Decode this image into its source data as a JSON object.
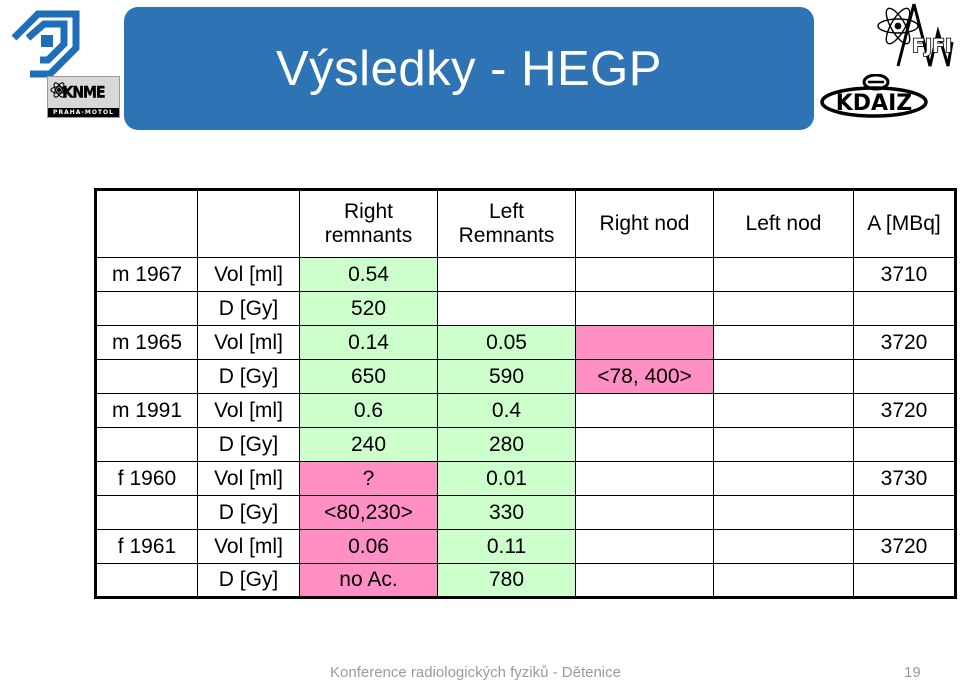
{
  "slide": {
    "title": "Výsledky - HEGP",
    "banner_color": "#2E74B5",
    "logos": {
      "motol_mark": "motol-diamond-logo",
      "knme_word": "KNME",
      "knme_sub": "PRAHA-MOTOL",
      "fjfi_word": "FJFI",
      "kdaiz_word": "KDAIZ"
    }
  },
  "footer": {
    "text": "Konference radiologických fyziků - Dětenice",
    "page": "19"
  },
  "table": {
    "headers": [
      "",
      "",
      "Right remnants",
      "Left Remnants",
      "Right nod",
      "Left nod",
      "A [MBq]"
    ],
    "header_lines": {
      "col3_line1": "Right",
      "col3_line2": "remnants",
      "col4_line1": "Left",
      "col4_line2": "Remnants",
      "col5": "Right nod",
      "col6": "Left nod",
      "col7": "A [MBq]"
    },
    "colors": {
      "green_bg": "#CCFFCC",
      "green_fg": "#006400",
      "pink_bg": "#FF8FC4",
      "pink_fg": "#800080"
    },
    "rows": [
      {
        "patient": "m 1967",
        "metric": "Vol [ml]",
        "right_remnants": "0.54",
        "left_remnants": "",
        "right_nod": "",
        "left_nod": "",
        "activity": "3710"
      },
      {
        "patient": "",
        "metric": "D [Gy]",
        "right_remnants": "520",
        "left_remnants": "",
        "right_nod": "",
        "left_nod": "",
        "activity": ""
      },
      {
        "patient": "m 1965",
        "metric": "Vol [ml]",
        "right_remnants": "0.14",
        "left_remnants": "0.05",
        "right_nod": "",
        "left_nod": "",
        "activity": "3720"
      },
      {
        "patient": "",
        "metric": "D [Gy]",
        "right_remnants": "650",
        "left_remnants": "590",
        "right_nod": "<78, 400>",
        "left_nod": "",
        "activity": ""
      },
      {
        "patient": "m 1991",
        "metric": "Vol [ml]",
        "right_remnants": "0.6",
        "left_remnants": "0.4",
        "right_nod": "",
        "left_nod": "",
        "activity": "3720"
      },
      {
        "patient": "",
        "metric": "D [Gy]",
        "right_remnants": "240",
        "left_remnants": "280",
        "right_nod": "",
        "left_nod": "",
        "activity": ""
      },
      {
        "patient": "f 1960",
        "metric": "Vol [ml]",
        "right_remnants": "?",
        "left_remnants": "0.01",
        "right_nod": "",
        "left_nod": "",
        "activity": "3730"
      },
      {
        "patient": "",
        "metric": "D [Gy]",
        "right_remnants": "<80,230>",
        "left_remnants": "330",
        "right_nod": "",
        "left_nod": "",
        "activity": ""
      },
      {
        "patient": "f 1961",
        "metric": "Vol [ml]",
        "right_remnants": "0.06",
        "left_remnants": "0.11",
        "right_nod": "",
        "left_nod": "",
        "activity": "3720"
      },
      {
        "patient": "",
        "metric": "D [Gy]",
        "right_remnants": "no Ac.",
        "left_remnants": "780",
        "right_nod": "",
        "left_nod": "",
        "activity": ""
      }
    ]
  }
}
